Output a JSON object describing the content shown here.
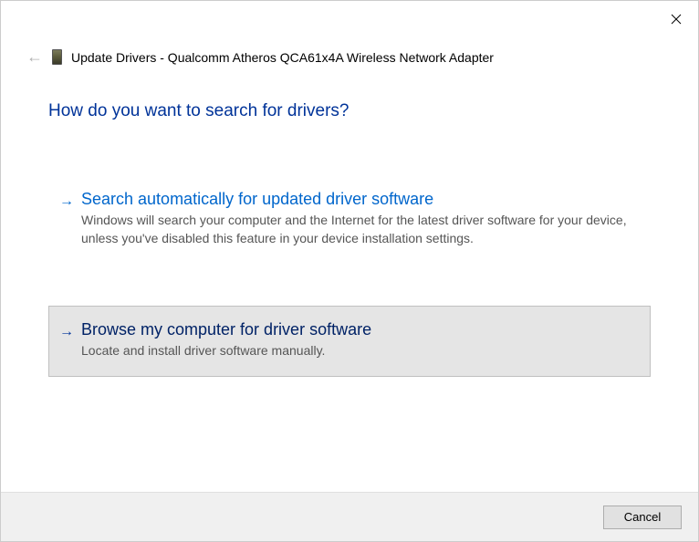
{
  "header": {
    "title": "Update Drivers - Qualcomm Atheros QCA61x4A Wireless Network Adapter"
  },
  "main": {
    "heading": "How do you want to search for drivers?"
  },
  "options": [
    {
      "title": "Search automatically for updated driver software",
      "description": "Windows will search your computer and the Internet for the latest driver software for your device, unless you've disabled this feature in your device installation settings."
    },
    {
      "title": "Browse my computer for driver software",
      "description": "Locate and install driver software manually."
    }
  ],
  "footer": {
    "cancel_label": "Cancel"
  }
}
